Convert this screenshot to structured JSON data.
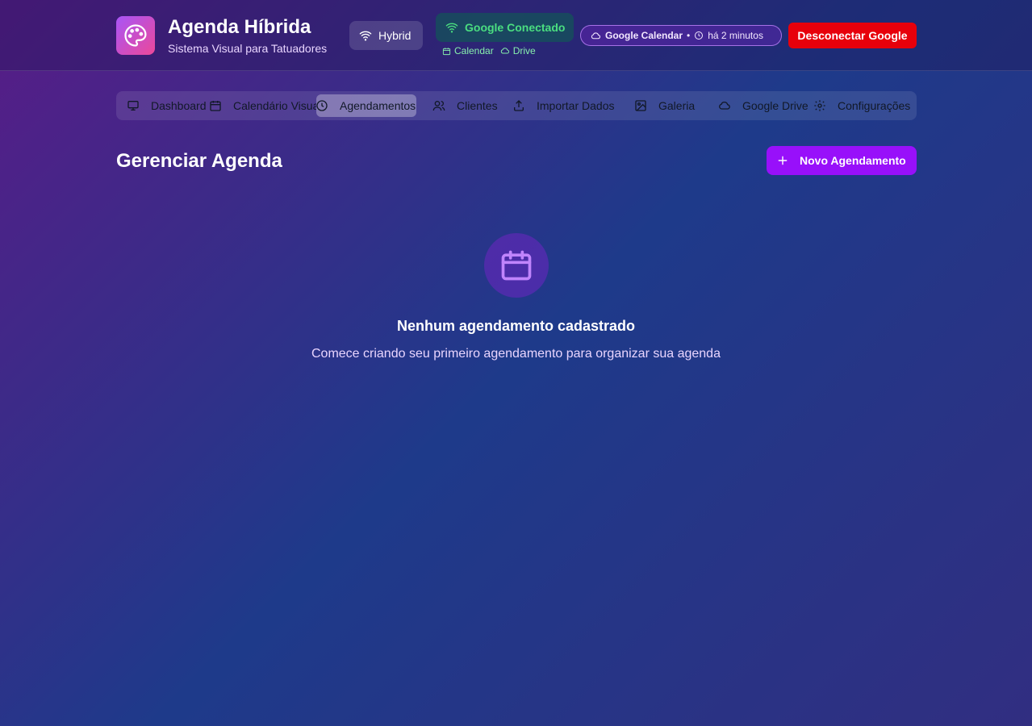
{
  "header": {
    "app_title": "Agenda Híbrida",
    "app_subtitle": "Sistema Visual para Tatuadores",
    "logo_icon": "palette-icon",
    "mode_badge": "Hybrid",
    "google_status": "Google Conectado",
    "google_services": [
      "Calendar",
      "Drive"
    ],
    "sync": {
      "service": "Google Calendar",
      "separator": "•",
      "last_sync": "há 2 minutos"
    },
    "disconnect_label": "Desconectar Google"
  },
  "tabs": [
    {
      "label": "Dashboard",
      "icon": "monitor-icon",
      "active": false
    },
    {
      "label": "Calendário Visual",
      "icon": "calendar-icon",
      "active": false
    },
    {
      "label": "Agendamentos",
      "icon": "clock-icon",
      "active": true
    },
    {
      "label": "Clientes",
      "icon": "users-icon",
      "active": false
    },
    {
      "label": "Importar Dados",
      "icon": "upload-icon",
      "active": false
    },
    {
      "label": "Galeria",
      "icon": "image-icon",
      "active": false
    },
    {
      "label": "Google Drive",
      "icon": "cloud-icon",
      "active": false
    },
    {
      "label": "Configurações",
      "icon": "gear-icon",
      "active": false
    }
  ],
  "main": {
    "title": "Gerenciar Agenda",
    "new_button": "Novo Agendamento",
    "empty_state": {
      "icon": "calendar-icon",
      "title": "Nenhum agendamento cadastrado",
      "description": "Comece criando seu primeiro agendamento para organizar sua agenda"
    }
  },
  "colors": {
    "bg_from": "#581c87",
    "bg_mid": "#1e3a8a",
    "accent": "#9810fa",
    "danger": "#e7000b",
    "success": "#4ade80"
  }
}
